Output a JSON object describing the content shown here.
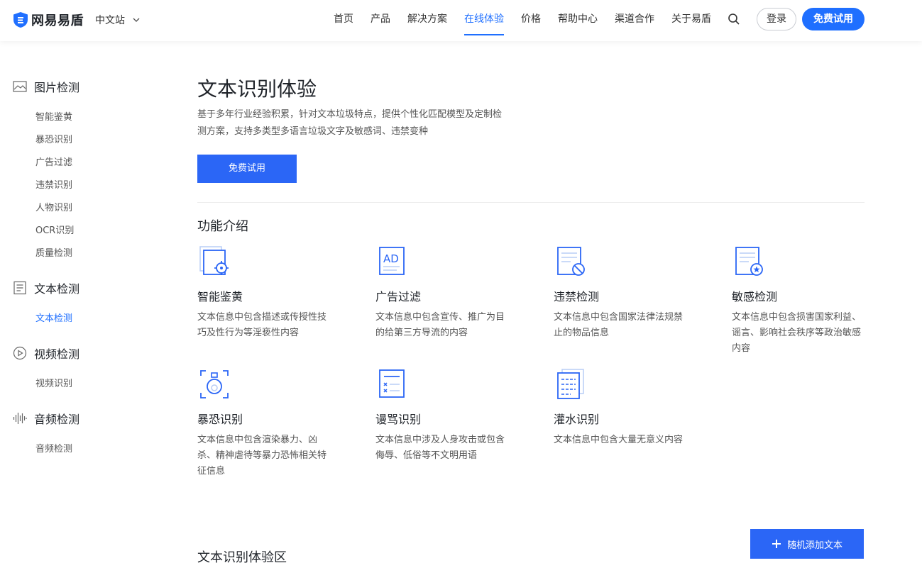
{
  "header": {
    "logo_text": "网易易盾",
    "site": "中文站",
    "nav": [
      {
        "label": "首页",
        "active": false
      },
      {
        "label": "产品",
        "active": false
      },
      {
        "label": "解决方案",
        "active": false
      },
      {
        "label": "在线体验",
        "active": true
      },
      {
        "label": "价格",
        "active": false
      },
      {
        "label": "帮助中心",
        "active": false
      },
      {
        "label": "渠道合作",
        "active": false
      },
      {
        "label": "关于易盾",
        "active": false
      }
    ],
    "login": "登录",
    "trial": "免费试用"
  },
  "sidebar": {
    "groups": [
      {
        "icon": "image-icon",
        "label": "图片检测",
        "items": [
          "智能鉴黄",
          "暴恐识别",
          "广告过滤",
          "违禁识别",
          "人物识别",
          "OCR识别",
          "质量检测"
        ]
      },
      {
        "icon": "document-icon",
        "label": "文本检测",
        "items": [
          "文本检测"
        ]
      },
      {
        "icon": "play-circle-icon",
        "label": "视频检测",
        "items": [
          "视频识别"
        ]
      },
      {
        "icon": "audio-wave-icon",
        "label": "音频检测",
        "items": [
          "音频检测"
        ]
      }
    ],
    "active_item": "文本检测"
  },
  "main": {
    "title": "文本识别体验",
    "description": "基于多年行业经验积累，针对文本垃圾特点，提供个性化匹配模型及定制检测方案，支持多类型多语言垃圾文字及敏感词、违禁变种",
    "cta": "免费试用",
    "section_title": "功能介绍",
    "features": [
      {
        "icon": "porn-detect-icon",
        "name": "智能鉴黄",
        "desc": "文本信息中包含描述或传授性技巧及性行为等淫亵性内容"
      },
      {
        "icon": "ad-icon",
        "name": "广告过滤",
        "desc": "文本信息中包含宣传、推广为目的给第三方导流的内容"
      },
      {
        "icon": "prohibited-icon",
        "name": "违禁检测",
        "desc": "文本信息中包含国家法律法规禁止的物品信息"
      },
      {
        "icon": "sensitive-icon",
        "name": "敏感检测",
        "desc": "文本信息中包含损害国家利益、谣言、影响社会秩序等政治敏感内容"
      },
      {
        "icon": "terror-icon",
        "name": "暴恐识别",
        "desc": "文本信息中包含渲染暴力、凶杀、精神虐待等暴力恐怖相关特征信息"
      },
      {
        "icon": "abuse-icon",
        "name": "谩骂识别",
        "desc": "文本信息中涉及人身攻击或包含侮辱、低俗等不文明用语"
      },
      {
        "icon": "spam-icon",
        "name": "灌水识别",
        "desc": "文本信息中包含大量无意义内容"
      }
    ],
    "add_text_button": "随机添加文本",
    "experience_title": "文本识别体验区"
  },
  "colors": {
    "primary": "#1f6fff",
    "button": "#2b66f6",
    "text": "#333333"
  }
}
